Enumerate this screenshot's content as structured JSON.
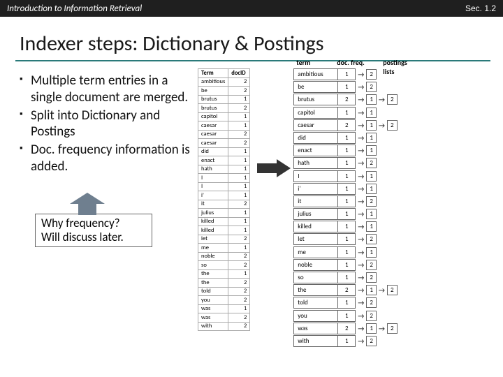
{
  "header": {
    "course": "Introduction to Information Retrieval",
    "section": "Sec. 1.2"
  },
  "title": "Indexer steps: Dictionary & Postings",
  "bullets": [
    "Multiple term entries in a single document are merged.",
    "Split into Dictionary and Postings",
    "Doc. frequency information is added."
  ],
  "callout": {
    "l1": "Why frequency?",
    "l2": "Will discuss later."
  },
  "src_table": {
    "headers": [
      "Term",
      "docID"
    ],
    "rows": [
      [
        "ambitious",
        "2"
      ],
      [
        "be",
        "2"
      ],
      [
        "brutus",
        "1"
      ],
      [
        "brutus",
        "2"
      ],
      [
        "capitol",
        "1"
      ],
      [
        "caesar",
        "1"
      ],
      [
        "caesar",
        "2"
      ],
      [
        "caesar",
        "2"
      ],
      [
        "did",
        "1"
      ],
      [
        "enact",
        "1"
      ],
      [
        "hath",
        "1"
      ],
      [
        "I",
        "1"
      ],
      [
        "I",
        "1"
      ],
      [
        "i'",
        "1"
      ],
      [
        "it",
        "2"
      ],
      [
        "julius",
        "1"
      ],
      [
        "killed",
        "1"
      ],
      [
        "killed",
        "1"
      ],
      [
        "let",
        "2"
      ],
      [
        "me",
        "1"
      ],
      [
        "noble",
        "2"
      ],
      [
        "so",
        "2"
      ],
      [
        "the",
        "1"
      ],
      [
        "the",
        "2"
      ],
      [
        "told",
        "2"
      ],
      [
        "you",
        "2"
      ],
      [
        "was",
        "1"
      ],
      [
        "was",
        "2"
      ],
      [
        "with",
        "2"
      ]
    ]
  },
  "dict_labels": {
    "term": "term",
    "docfreq": "doc. freq.",
    "post": "postings lists"
  },
  "dict": [
    {
      "t": "ambitious",
      "f": "1",
      "p": [
        "2"
      ]
    },
    {
      "t": "be",
      "f": "1",
      "p": [
        "2"
      ]
    },
    {
      "t": "brutus",
      "f": "2",
      "p": [
        "1",
        "2"
      ]
    },
    {
      "t": "capitol",
      "f": "1",
      "p": [
        "1"
      ]
    },
    {
      "t": "caesar",
      "f": "2",
      "p": [
        "1",
        "2"
      ]
    },
    {
      "t": "did",
      "f": "1",
      "p": [
        "1"
      ]
    },
    {
      "t": "enact",
      "f": "1",
      "p": [
        "1"
      ]
    },
    {
      "t": "hath",
      "f": "1",
      "p": [
        "2"
      ]
    },
    {
      "t": "I",
      "f": "1",
      "p": [
        "1"
      ]
    },
    {
      "t": "i'",
      "f": "1",
      "p": [
        "1"
      ]
    },
    {
      "t": "it",
      "f": "1",
      "p": [
        "2"
      ]
    },
    {
      "t": "julius",
      "f": "1",
      "p": [
        "1"
      ]
    },
    {
      "t": "killed",
      "f": "1",
      "p": [
        "1"
      ]
    },
    {
      "t": "let",
      "f": "1",
      "p": [
        "2"
      ]
    },
    {
      "t": "me",
      "f": "1",
      "p": [
        "1"
      ]
    },
    {
      "t": "noble",
      "f": "1",
      "p": [
        "2"
      ]
    },
    {
      "t": "so",
      "f": "1",
      "p": [
        "2"
      ]
    },
    {
      "t": "the",
      "f": "2",
      "p": [
        "1",
        "2"
      ]
    },
    {
      "t": "told",
      "f": "1",
      "p": [
        "2"
      ]
    },
    {
      "t": "you",
      "f": "1",
      "p": [
        "2"
      ]
    },
    {
      "t": "was",
      "f": "2",
      "p": [
        "1",
        "2"
      ]
    },
    {
      "t": "with",
      "f": "1",
      "p": [
        "2"
      ]
    }
  ]
}
